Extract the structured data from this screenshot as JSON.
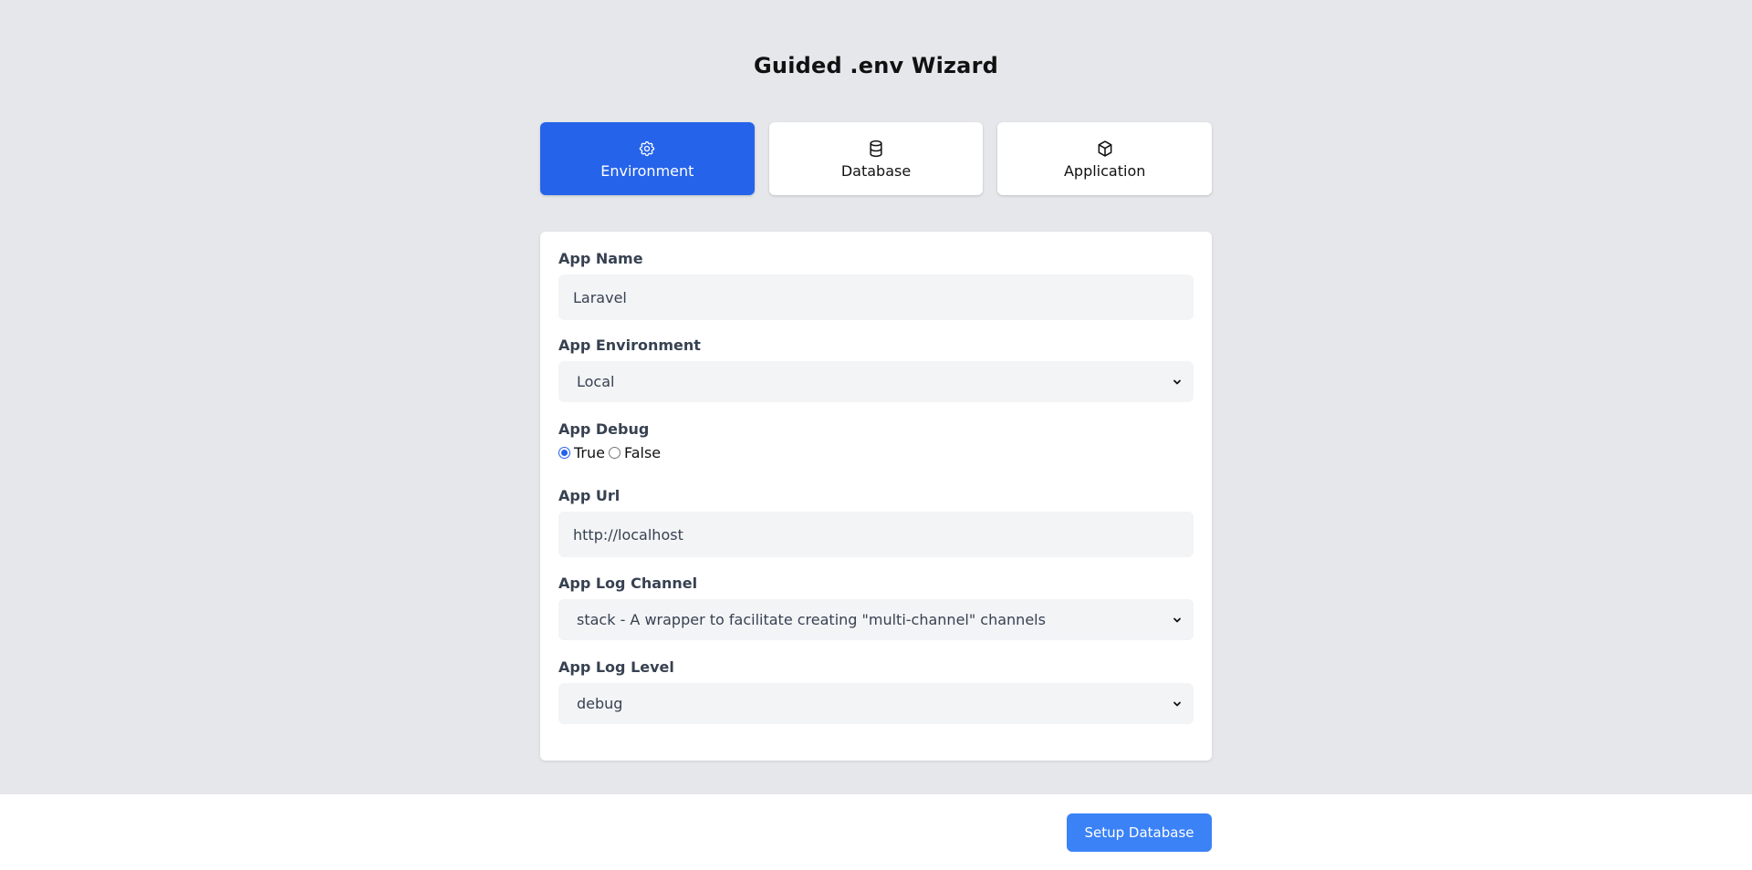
{
  "page": {
    "title": "Guided .env Wizard"
  },
  "steps": [
    {
      "label": "Environment",
      "icon": "gear-icon",
      "active": true
    },
    {
      "label": "Database",
      "icon": "database-icon",
      "active": false
    },
    {
      "label": "Application",
      "icon": "cube-icon",
      "active": false
    }
  ],
  "form": {
    "app_name": {
      "label": "App Name",
      "value": "Laravel"
    },
    "app_environment": {
      "label": "App Environment",
      "selected": "Local"
    },
    "app_debug": {
      "label": "App Debug",
      "options": [
        {
          "label": "True",
          "checked": true
        },
        {
          "label": "False",
          "checked": false
        }
      ]
    },
    "app_url": {
      "label": "App Url",
      "value": "http://localhost"
    },
    "app_log_channel": {
      "label": "App Log Channel",
      "selected": "stack - A wrapper to facilitate creating \"multi-channel\" channels"
    },
    "app_log_level": {
      "label": "App Log Level",
      "selected": "debug"
    }
  },
  "footer": {
    "next_button": "Setup Database"
  },
  "colors": {
    "accent": "#2563eb",
    "button": "#3b82f6",
    "background": "#e5e7eb",
    "input_bg": "#f3f4f6"
  }
}
